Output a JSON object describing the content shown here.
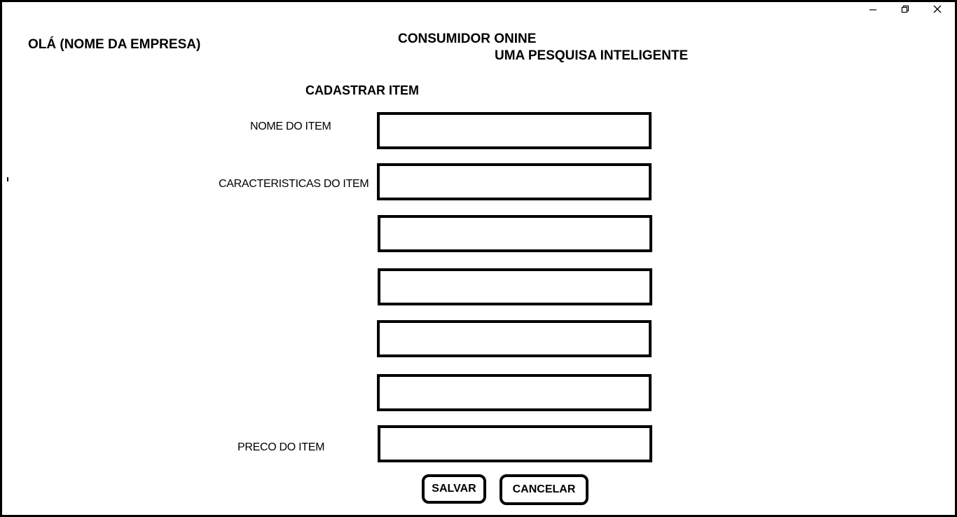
{
  "window": {
    "controls": [
      "minimize-icon",
      "restore-icon",
      "close-icon"
    ]
  },
  "header": {
    "company": "OLÁ (NOME DA EMPRESA)",
    "app_title": "CONSUMIDOR ONINE",
    "app_subtitle": "UMA PESQUISA INTELIGENTE"
  },
  "form": {
    "title": "CADASTRAR ITEM",
    "labels": {
      "name": "NOME DO ITEM",
      "characteristics": "CARACTERISTICAS DO ITEM",
      "price": "PRECO DO ITEM"
    },
    "fields": {
      "name": "",
      "characteristics": [
        "",
        "",
        "",
        "",
        ""
      ],
      "price": ""
    }
  },
  "actions": {
    "save_label": "SALVAR",
    "cancel_label": "CANCELAR"
  }
}
